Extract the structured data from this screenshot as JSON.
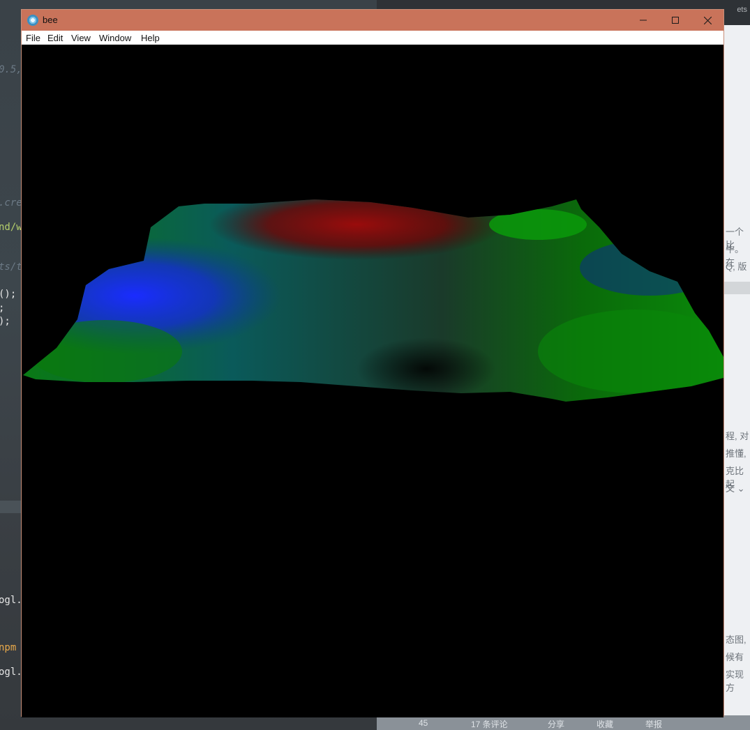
{
  "window": {
    "title": "bee",
    "menu": [
      "File",
      "Edit",
      "View",
      "Window",
      "Help"
    ],
    "controls": {
      "minimize": "—",
      "maximize": "☐",
      "close": "✕"
    }
  },
  "colors": {
    "titlebar": "#c9735a",
    "viewport": "#000000",
    "terrain_green": "#0a8a0a",
    "terrain_blue": "#1a2cff",
    "terrain_red": "#8a0a0a"
  },
  "background": {
    "editor_lines": [
      {
        "text": "0.5,",
        "style": "comment"
      },
      {
        "text": ".cre",
        "style": "comment"
      },
      {
        "text": "nd/w",
        "style": "green"
      },
      {
        "text": "ts/t",
        "style": "comment"
      },
      {
        "text": "();",
        "style": "white"
      },
      {
        "text": ";",
        "style": "white"
      },
      {
        "text": ");",
        "style": "white"
      },
      {
        "text": "ogl.",
        "style": "white"
      },
      {
        "text": " npm",
        "style": "orange"
      },
      {
        "text": "ogl.",
        "style": "white"
      }
    ],
    "browser_fragments": [
      "程",
      "一个比",
      "牛。在",
      "Q, 版",
      "程, 对",
      "推懂,",
      "克比起",
      "文 ⌄",
      "态图,",
      "候有",
      "实现方"
    ],
    "tab_fragment": "ets",
    "bottom_bar": [
      "45",
      "17 条评论",
      "分享",
      "收藏",
      "举报"
    ]
  }
}
